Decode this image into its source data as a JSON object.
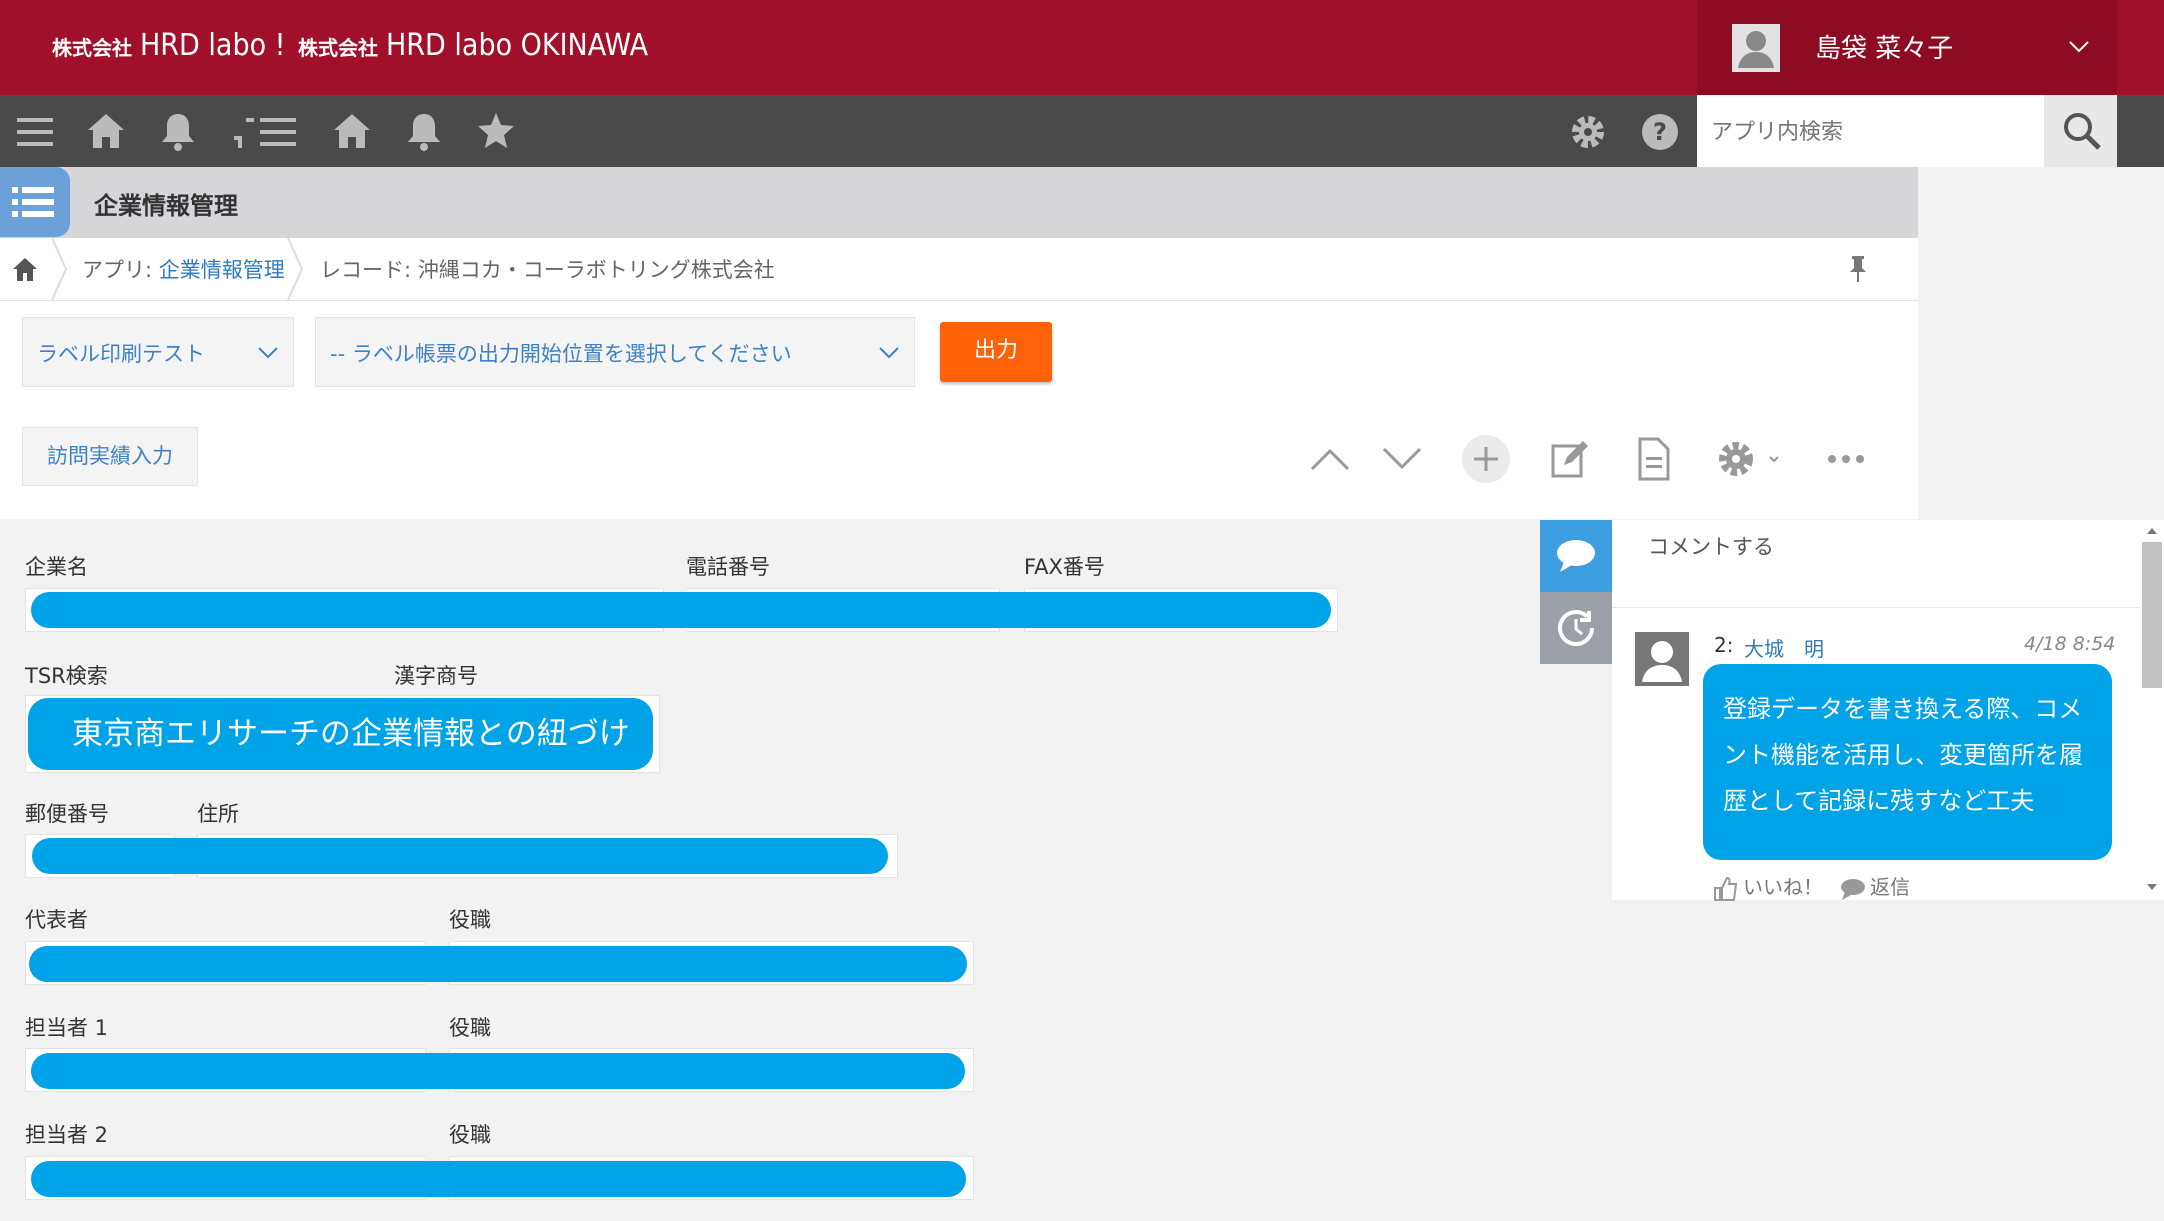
{
  "header": {
    "logo1_small": "株式会社",
    "logo1_big": "HRD labo !",
    "logo2_small": "株式会社",
    "logo2_big": "HRD labo OKINAWA",
    "user_name": "島袋 菜々子"
  },
  "toolbar": {
    "search_placeholder": "アプリ内検索"
  },
  "app": {
    "title": "企業情報管理"
  },
  "breadcrumb": {
    "app_prefix": "アプリ: ",
    "app_name": "企業情報管理",
    "record": "レコード: 沖縄コカ・コーラボトリング株式会社"
  },
  "actions": {
    "template_select": "ラベル印刷テスト",
    "position_select": "-- ラベル帳票の出力開始位置を選択してください",
    "output_button": "出力",
    "visit_button": "訪問実績入力"
  },
  "form": {
    "company_name": "企業名",
    "phone": "電話番号",
    "fax": "FAX番号",
    "tsr_search": "TSR検索",
    "kanji_name": "漢字商号",
    "tsr_button": "東京商エリサーチの企業情報との紐づけ",
    "postal_code": "郵便番号",
    "address": "住所",
    "representative": "代表者",
    "title1": "役職",
    "contact1": "担当者 1",
    "title2": "役職",
    "contact2": "担当者 2",
    "title3": "役職"
  },
  "comments": {
    "input_placeholder": "コメントする",
    "items": [
      {
        "number": "2:",
        "user": "大城　明",
        "time": "4/18 8:54",
        "text": "登録データを書き換える際、コメント機能を活用し、変更箇所を履歴として記録に残すなど工夫",
        "like_label": "いいね！",
        "reply_label": "返信"
      }
    ]
  },
  "colors": {
    "header": "#a11029",
    "toolbar": "#4a4a4a",
    "accent": "#00a2e8",
    "output_button": "#ff6208"
  },
  "icons": [
    "hamburger-icon",
    "home-icon",
    "bell-icon",
    "star-icon",
    "gear-icon",
    "help-icon",
    "search-icon",
    "chevron-down-icon",
    "pin-icon",
    "list-icon",
    "chevron-up-icon",
    "plus-icon",
    "edit-icon",
    "copy-icon",
    "more-icon",
    "comment-icon",
    "history-icon",
    "like-icon",
    "reply-icon"
  ]
}
